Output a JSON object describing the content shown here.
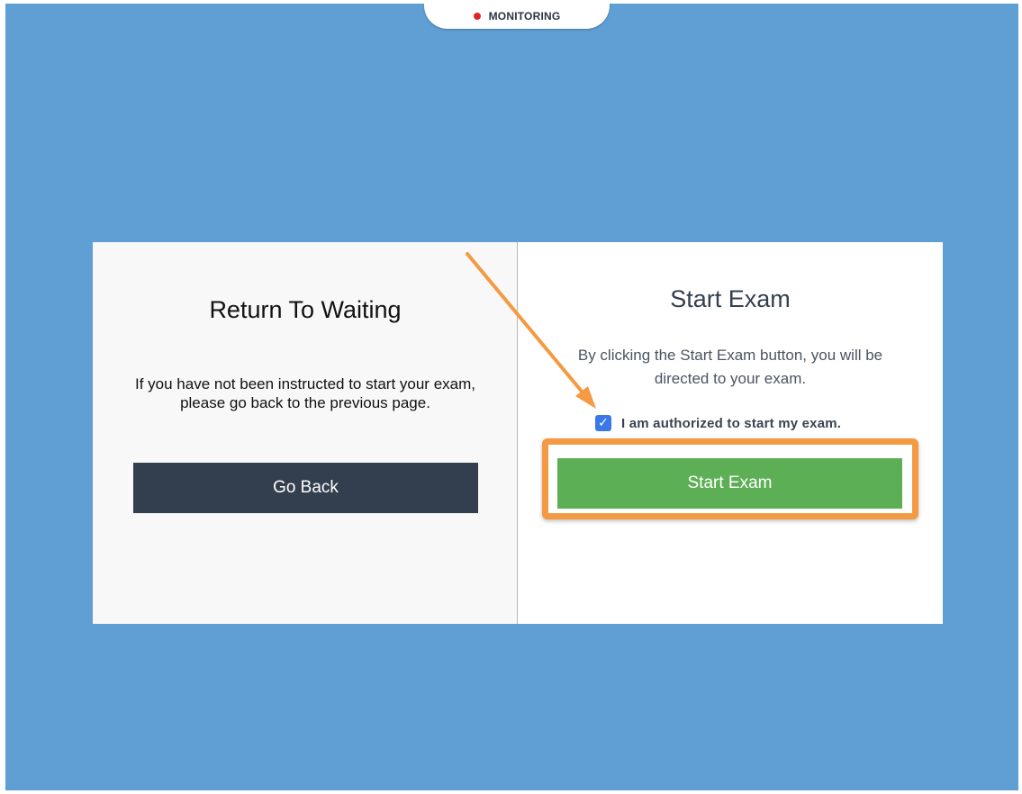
{
  "monitor": {
    "label": "MONITORING"
  },
  "left_panel": {
    "title": "Return To Waiting",
    "body": "If you have not been instructed to start your exam, please go back to the previous page.",
    "button_label": "Go Back"
  },
  "right_panel": {
    "title": "Start Exam",
    "body": "By clicking the Start Exam button, you will be directed to your exam.",
    "checkbox": {
      "label": "I am authorized to start my exam.",
      "checked": true,
      "icon": "check-icon"
    },
    "button_label": "Start Exam"
  },
  "colors": {
    "background": "#5f9fd4",
    "go_back_button": "#333e4e",
    "start_button": "#5daf55",
    "highlight": "#f39a43",
    "checkbox": "#3b78e7",
    "recording_dot": "#e0262b"
  },
  "annotations": {
    "arrow_icon": "arrow-icon",
    "highlight": "orange-highlight-frame"
  }
}
